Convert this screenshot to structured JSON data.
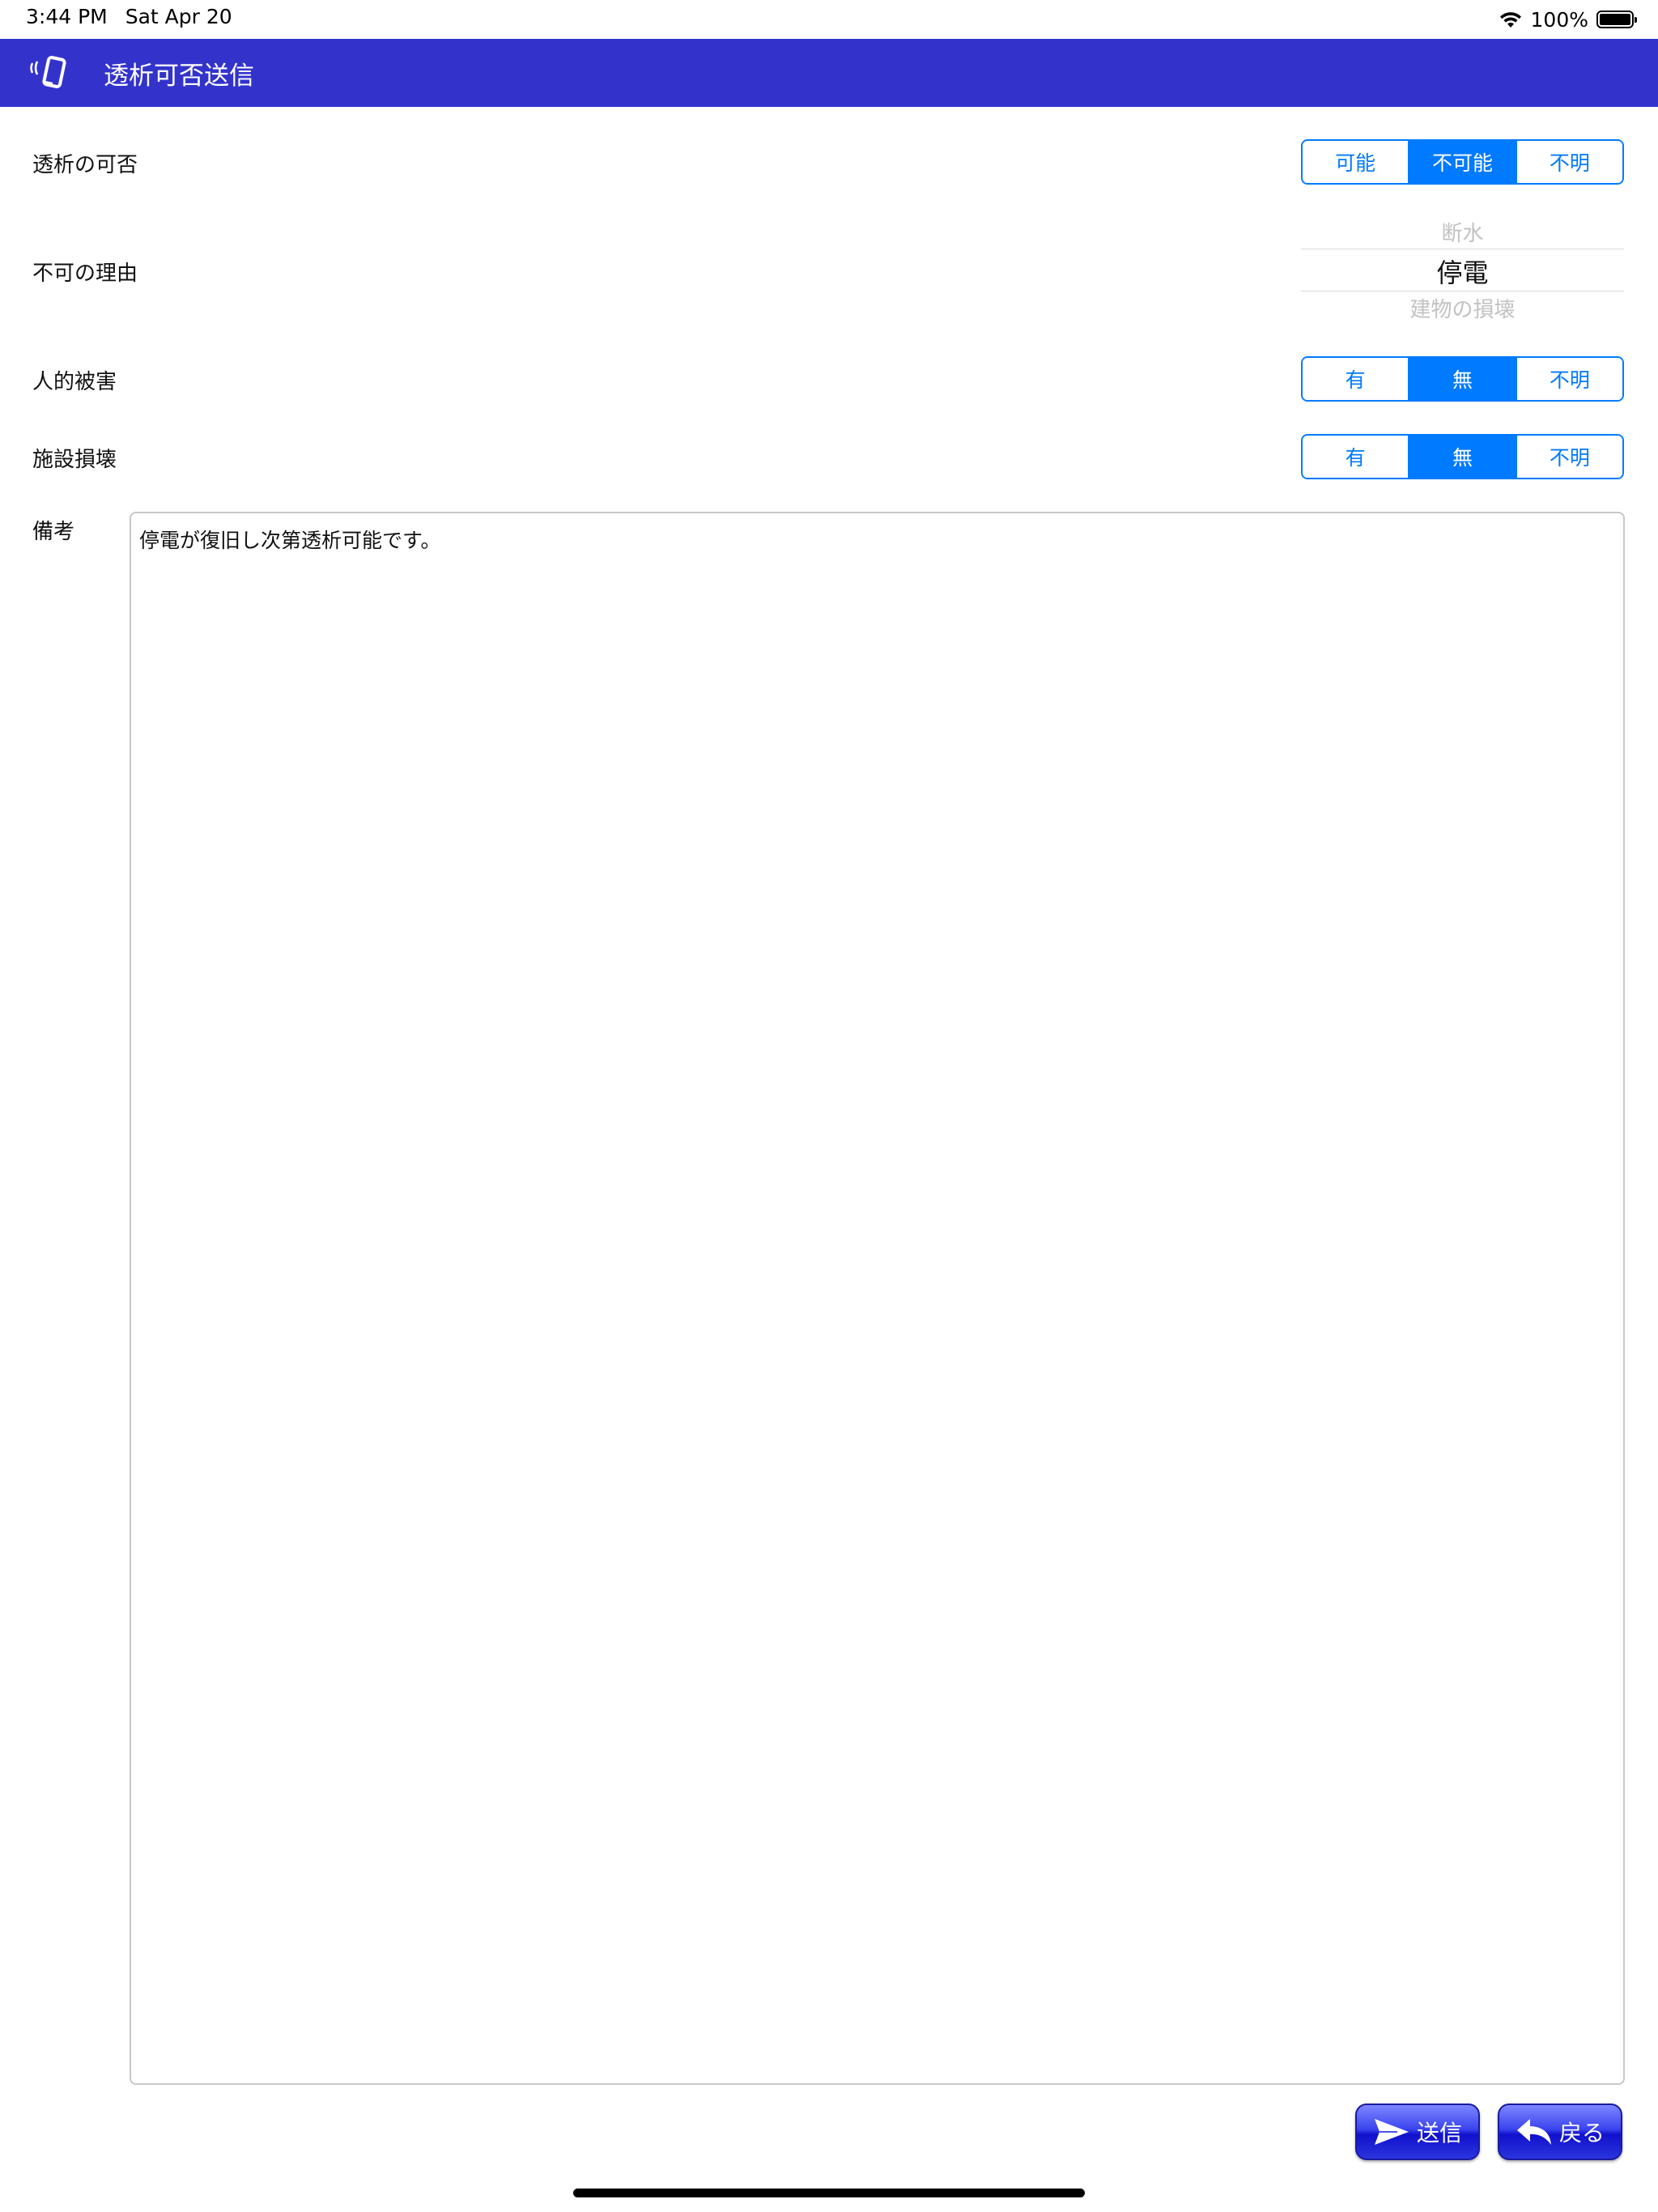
{
  "status_bar": {
    "time": "3:44 PM",
    "date": "Sat Apr 20",
    "battery": "100%",
    "icons": [
      "wifi-icon",
      "battery-icon"
    ]
  },
  "nav": {
    "title": "透析可否送信",
    "icon": "vibrating-phone-icon"
  },
  "form": {
    "dialysis": {
      "label": "透析の可否",
      "options": [
        "可能",
        "不可能",
        "不明"
      ],
      "selected": "不可能"
    },
    "reason": {
      "label": "不可の理由",
      "prev": "断水",
      "current": "停電",
      "next": "建物の損壊"
    },
    "human_damage": {
      "label": "人的被害",
      "options": [
        "有",
        "無",
        "不明"
      ],
      "selected": "無"
    },
    "facility_damage": {
      "label": "施設損壊",
      "options": [
        "有",
        "無",
        "不明"
      ],
      "selected": "無"
    },
    "notes": {
      "label": "備考",
      "value": "停電が復旧し次第透析可能です。"
    }
  },
  "actions": {
    "send_label": "送信",
    "back_label": "戻る",
    "send_icon": "paper-plane-icon",
    "back_icon": "reply-arrow-icon"
  },
  "colors": {
    "nav_bar": "#3333cc",
    "accent": "#007aff"
  }
}
